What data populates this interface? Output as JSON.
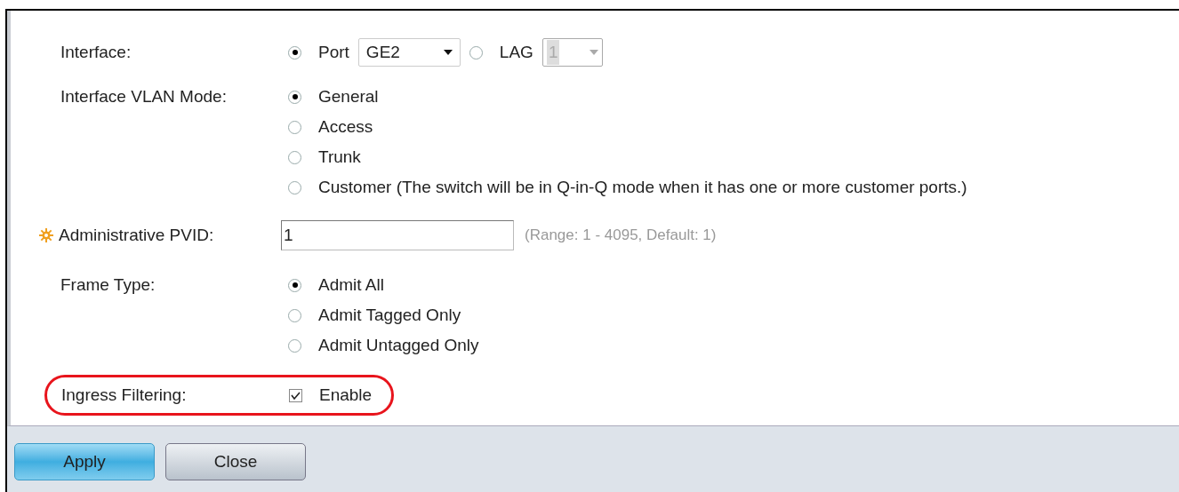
{
  "interface": {
    "label": "Interface:",
    "options": [
      {
        "label": "Port",
        "selected": true,
        "dropdown": {
          "value": "GE2",
          "disabled": false
        }
      },
      {
        "label": "LAG",
        "selected": false,
        "dropdown": {
          "value": "1",
          "disabled": true
        }
      }
    ]
  },
  "vlan_mode": {
    "label": "Interface VLAN Mode:",
    "options": [
      {
        "label": "General",
        "selected": true
      },
      {
        "label": "Access",
        "selected": false
      },
      {
        "label": "Trunk",
        "selected": false
      },
      {
        "label": "Customer (The switch will be in Q-in-Q mode when it has one or more customer ports.)",
        "selected": false
      }
    ]
  },
  "pvid": {
    "label": "Administrative PVID:",
    "required": true,
    "value": "1",
    "hint": "(Range: 1 - 4095, Default: 1)"
  },
  "frame_type": {
    "label": "Frame Type:",
    "options": [
      {
        "label": "Admit All",
        "selected": true
      },
      {
        "label": "Admit Tagged Only",
        "selected": false
      },
      {
        "label": "Admit Untagged Only",
        "selected": false
      }
    ]
  },
  "ingress_filtering": {
    "label": "Ingress Filtering:",
    "option": "Enable",
    "checked": true,
    "highlighted": true
  },
  "buttons": [
    {
      "label": "Apply",
      "kind": "primary"
    },
    {
      "label": "Close",
      "kind": "secondary"
    }
  ]
}
